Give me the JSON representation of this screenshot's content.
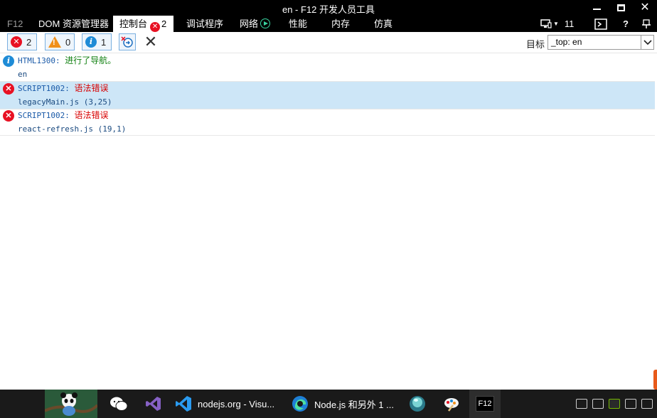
{
  "window": {
    "title": "en - F12 开发人员工具",
    "minimize": "minimize",
    "maximize": "maximize",
    "close": "close"
  },
  "tabs": [
    {
      "label": "F12",
      "state": "dim"
    },
    {
      "label": "DOM 资源管理器"
    },
    {
      "label": "控制台",
      "active": true,
      "error_count": "2"
    },
    {
      "label": "调试程序"
    },
    {
      "label": "网络",
      "icon": "play-icon"
    },
    {
      "label": "性能"
    },
    {
      "label": "内存"
    },
    {
      "label": "仿真"
    }
  ],
  "tab_right": {
    "device_count": "11",
    "help": "?"
  },
  "toolbar": {
    "errors": "2",
    "warnings": "0",
    "infos": "1",
    "target_label": "目标",
    "target_value": "_top: en"
  },
  "messages": [
    {
      "type": "info",
      "code": "HTML1300:",
      "text": "进行了导航。",
      "source": "en",
      "selected": false
    },
    {
      "type": "error",
      "code": "SCRIPT1002:",
      "text": "语法错误",
      "source": "legacyMain.js (3,25)",
      "selected": true
    },
    {
      "type": "error",
      "code": "SCRIPT1002:",
      "text": "语法错误",
      "source": "react-refresh.js (19,1)",
      "selected": false
    }
  ],
  "taskbar": {
    "items": [
      {
        "label": "",
        "icon": "panda-wallpaper-icon"
      },
      {
        "label": "",
        "icon": "wechat-icon"
      },
      {
        "label": "",
        "icon": "visual-studio-icon"
      },
      {
        "label": "nodejs.org - Visu...",
        "icon": "vscode-icon"
      },
      {
        "label": "Node.js 和另外 1 ...",
        "icon": "edge-icon"
      },
      {
        "label": "",
        "icon": "app-orb-icon"
      },
      {
        "label": "",
        "icon": "paint-icon"
      },
      {
        "label": "F12",
        "icon": "f12-icon",
        "active": true
      }
    ]
  },
  "colors": {
    "chrome_bg": "#000000",
    "error": "#e81123",
    "warning": "#f0901a",
    "info": "#1e8bd6",
    "selected_row": "#cde6f7",
    "code_blue": "#1a5aa8",
    "info_text": "#108010",
    "error_text": "#d80000"
  }
}
